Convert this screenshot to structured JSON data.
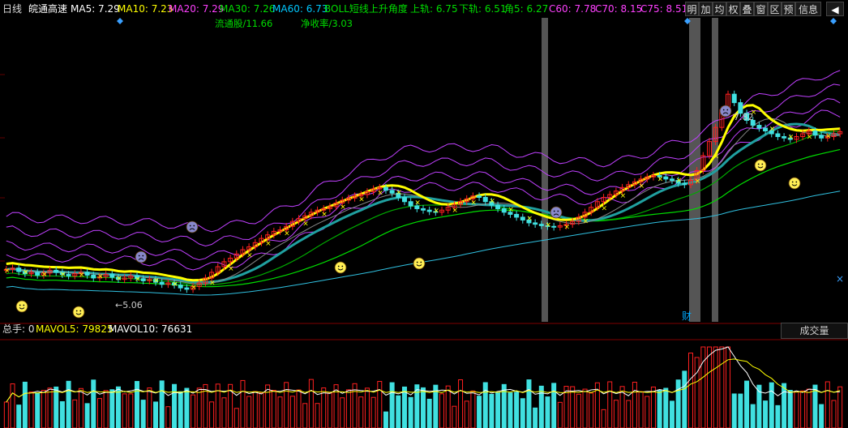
{
  "header": {
    "period": "日线",
    "stock_name": "皖通高速",
    "ma5": "MA5: 7.29",
    "ma10": "MA10: 7.23",
    "ma20": "MA20: 7.29",
    "ma30": "MA30: 7.26",
    "ma60": "MA60: 6.73",
    "boll": "BOLL短线上升角度",
    "upper": "上轨: 6.75",
    "lower": "下轨: 6.51",
    "angle": "角5: 6.27",
    "c60": "C60: 7.78",
    "c70": "C70: 8.15",
    "c75": "C75: 8.51"
  },
  "sub_header": {
    "float_shares": "流通股/11.66",
    "return_rate": "净收率/3.03"
  },
  "toolbar": {
    "buttons": [
      "明",
      "加",
      "均",
      "权",
      "叠",
      "窗",
      "区",
      "预",
      "信息"
    ],
    "arrow": "◀"
  },
  "annotations": {
    "low_label": "5.06",
    "high_label": "7.82",
    "cai_label": "财"
  },
  "volume_header": {
    "total": "总手: 0",
    "mavol5": "MAVOL5: 79825",
    "mavol10": "MAVOL10: 76631",
    "volume_button": "成交量"
  },
  "colors": {
    "background": "#000000",
    "up": "#ff2020",
    "down": "#40e0e0",
    "ma_yellow": "#ffff00",
    "ma_magenta": "#ff40ff",
    "ma_green": "#00dd00",
    "ma_cyan": "#00c8ff",
    "boll_purple": "#c040ff"
  },
  "chart_data": {
    "type": "candlestick",
    "price_range": [
      4.6,
      8.9
    ],
    "closes": [
      5.34,
      5.36,
      5.31,
      5.28,
      5.3,
      5.26,
      5.29,
      5.33,
      5.3,
      5.27,
      5.25,
      5.28,
      5.3,
      5.26,
      5.22,
      5.24,
      5.27,
      5.23,
      5.2,
      5.22,
      5.25,
      5.21,
      5.18,
      5.2,
      5.16,
      5.13,
      5.15,
      5.12,
      5.08,
      5.06,
      5.1,
      5.15,
      5.22,
      5.3,
      5.38,
      5.45,
      5.5,
      5.56,
      5.62,
      5.66,
      5.72,
      5.78,
      5.83,
      5.88,
      5.9,
      5.95,
      6.02,
      6.06,
      6.1,
      6.15,
      6.18,
      6.2,
      6.23,
      6.28,
      6.32,
      6.35,
      6.38,
      6.4,
      6.44,
      6.48,
      6.5,
      6.46,
      6.42,
      6.36,
      6.3,
      6.24,
      6.2,
      6.18,
      6.16,
      6.15,
      6.18,
      6.22,
      6.26,
      6.3,
      6.34,
      6.38,
      6.36,
      6.3,
      6.25,
      6.2,
      6.15,
      6.12,
      6.08,
      6.04,
      6.0,
      5.98,
      5.96,
      5.95,
      5.94,
      5.96,
      5.98,
      6.02,
      6.08,
      6.15,
      6.22,
      6.3,
      6.36,
      6.4,
      6.45,
      6.5,
      6.54,
      6.58,
      6.62,
      6.65,
      6.67,
      6.65,
      6.62,
      6.6,
      6.56,
      6.54,
      6.6,
      6.74,
      6.95,
      7.15,
      7.35,
      7.6,
      7.82,
      7.7,
      7.55,
      7.45,
      7.38,
      7.34,
      7.3,
      7.26,
      7.22,
      7.2,
      7.18,
      7.22,
      7.26,
      7.3,
      7.24,
      7.2,
      7.22,
      7.26,
      7.29
    ],
    "mavol": {
      "MAVOL5": 79825,
      "MAVOL10": 76631
    }
  }
}
